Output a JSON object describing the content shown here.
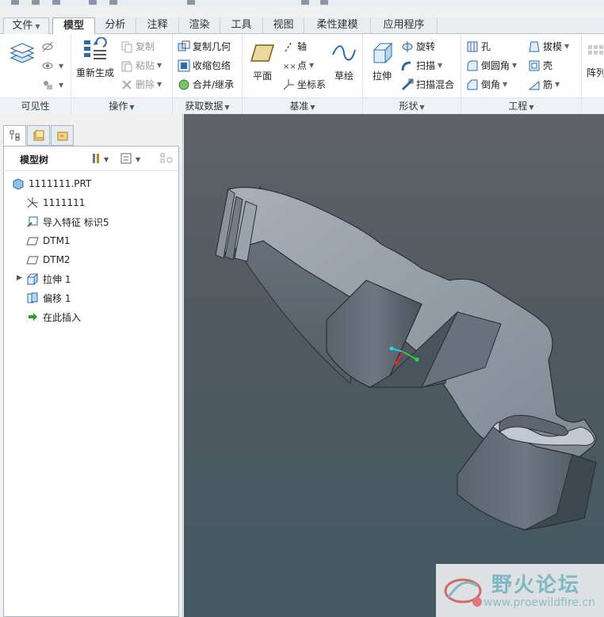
{
  "tabs": [
    {
      "label": "文件",
      "key": "file"
    },
    {
      "label": "模型",
      "key": "model",
      "active": true
    },
    {
      "label": "分析",
      "key": "analysis"
    },
    {
      "label": "注释",
      "key": "annotate"
    },
    {
      "label": "渲染",
      "key": "render"
    },
    {
      "label": "工具",
      "key": "tools"
    },
    {
      "label": "视图",
      "key": "view"
    },
    {
      "label": "柔性建模",
      "key": "flex"
    },
    {
      "label": "应用程序",
      "key": "apps"
    }
  ],
  "ribbon": {
    "visibility": {
      "label": "可见性"
    },
    "operations": {
      "label": "操作",
      "regenerate": "重新生成",
      "copy": "复制",
      "paste": "粘贴",
      "delete": "删除"
    },
    "get_data": {
      "label": "获取数据",
      "copy_geom": "复制几何",
      "shrinkwrap": "收缩包络",
      "merge": "合并/继承"
    },
    "datum": {
      "label": "基准",
      "plane": "平面",
      "axis": "轴",
      "point": "点",
      "csys": "坐标系",
      "sketch": "草绘"
    },
    "shapes": {
      "label": "形状",
      "extrude": "拉伸",
      "revolve": "旋转",
      "sweep": "扫描",
      "swept_blend": "扫描混合"
    },
    "engineering": {
      "label": "工程",
      "hole": "孔",
      "round": "倒圆角",
      "chamfer": "倒角",
      "draft": "拔模",
      "shell": "壳",
      "rib": "筋"
    },
    "pattern": {
      "label": "阵列"
    }
  },
  "model_tree": {
    "title": "模型树",
    "items": [
      {
        "label": "1111111.PRT",
        "icon": "part-icon"
      },
      {
        "label": "1111111",
        "icon": "csys-icon"
      },
      {
        "label": "导入特征 标识5",
        "icon": "import-feature-icon"
      },
      {
        "label": "DTM1",
        "icon": "datum-plane-icon"
      },
      {
        "label": "DTM2",
        "icon": "datum-plane-icon"
      },
      {
        "label": "拉伸 1",
        "icon": "extrude-icon",
        "expandable": true
      },
      {
        "label": "偏移 1",
        "icon": "offset-icon"
      },
      {
        "label": "在此插入",
        "icon": "insert-here-icon"
      }
    ]
  },
  "watermark": {
    "title": "野火论坛",
    "url": "www.proewildfire.cn"
  },
  "colors": {
    "accent": "#3a7fc4",
    "viewport_top": "#5f6269",
    "viewport_bottom": "#435a64"
  }
}
